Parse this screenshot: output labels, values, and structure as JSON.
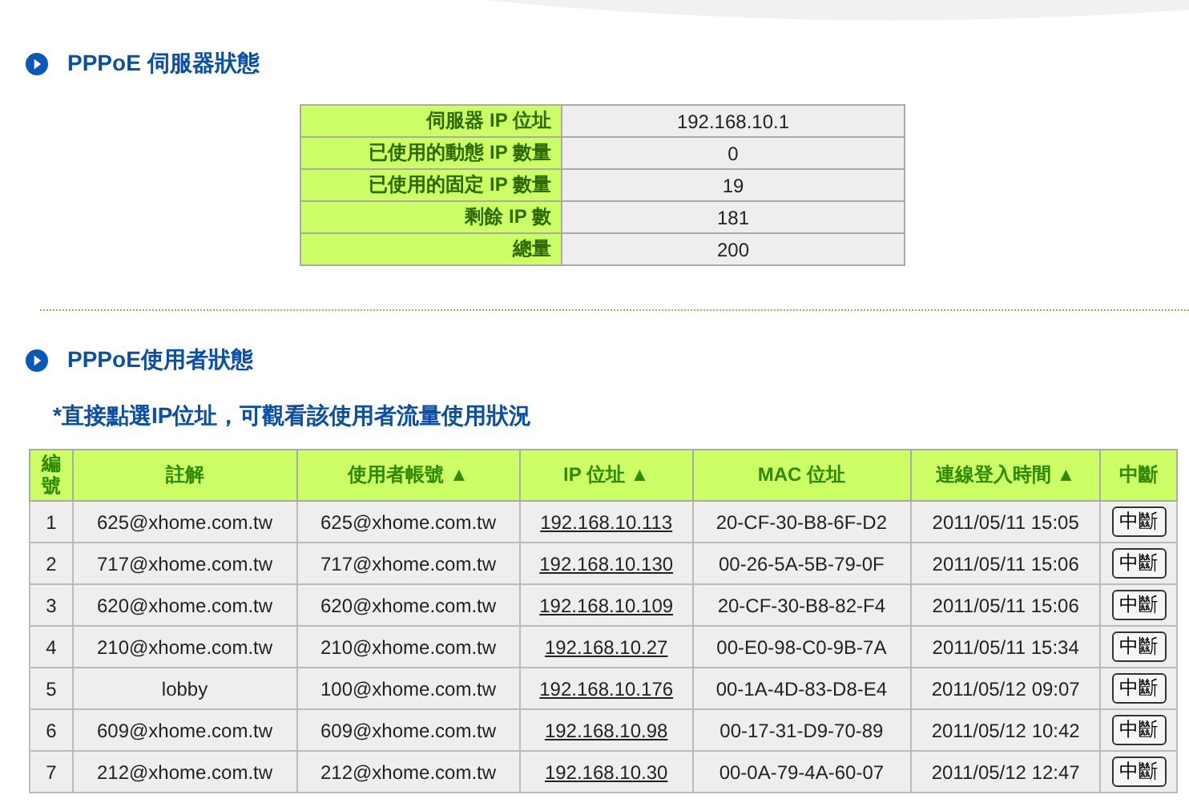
{
  "server_section": {
    "title": "PPPoE 伺服器狀態",
    "rows": [
      {
        "label": "伺服器 IP 位址",
        "value": "192.168.10.1"
      },
      {
        "label": "已使用的動態 IP 數量",
        "value": "0"
      },
      {
        "label": "已使用的固定 IP 數量",
        "value": "19"
      },
      {
        "label": "剩餘 IP 數",
        "value": "181"
      },
      {
        "label": "總量",
        "value": "200"
      }
    ]
  },
  "user_section": {
    "title": "PPPoE使用者狀態",
    "note": "*直接點選IP位址，可觀看該使用者流量使用狀況",
    "table": {
      "columns": [
        "編號",
        "註解",
        "使用者帳號 ▲",
        "IP 位址 ▲",
        "MAC 位址",
        "連線登入時間 ▲",
        "中斷"
      ],
      "rows": [
        {
          "no": "1",
          "comment": "625@xhome.com.tw",
          "account": "625@xhome.com.tw",
          "ip": "192.168.10.113",
          "mac": "20-CF-30-B8-6F-D2",
          "login_time": "2011/05/11 15:05",
          "action": "中斷"
        },
        {
          "no": "2",
          "comment": "717@xhome.com.tw",
          "account": "717@xhome.com.tw",
          "ip": "192.168.10.130",
          "mac": "00-26-5A-5B-79-0F",
          "login_time": "2011/05/11 15:06",
          "action": "中斷"
        },
        {
          "no": "3",
          "comment": "620@xhome.com.tw",
          "account": "620@xhome.com.tw",
          "ip": "192.168.10.109",
          "mac": "20-CF-30-B8-82-F4",
          "login_time": "2011/05/11 15:06",
          "action": "中斷"
        },
        {
          "no": "4",
          "comment": "210@xhome.com.tw",
          "account": "210@xhome.com.tw",
          "ip": "192.168.10.27",
          "mac": "00-E0-98-C0-9B-7A",
          "login_time": "2011/05/11 15:34",
          "action": "中斷"
        },
        {
          "no": "5",
          "comment": "lobby",
          "account": "100@xhome.com.tw",
          "ip": "192.168.10.176",
          "mac": "00-1A-4D-83-D8-E4",
          "login_time": "2011/05/12 09:07",
          "action": "中斷"
        },
        {
          "no": "6",
          "comment": "609@xhome.com.tw",
          "account": "609@xhome.com.tw",
          "ip": "192.168.10.98",
          "mac": "00-17-31-D9-70-89",
          "login_time": "2011/05/12 10:42",
          "action": "中斷"
        },
        {
          "no": "7",
          "comment": "212@xhome.com.tw",
          "account": "212@xhome.com.tw",
          "ip": "192.168.10.30",
          "mac": "00-0A-79-4A-60-07",
          "login_time": "2011/05/12 12:47",
          "action": "中斷"
        }
      ]
    }
  }
}
